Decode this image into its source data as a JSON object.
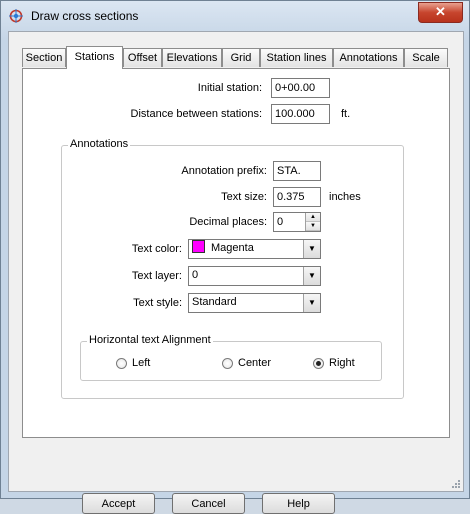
{
  "window": {
    "title": "Draw cross sections",
    "close_label": "✕"
  },
  "tabs": [
    {
      "label": "Section"
    },
    {
      "label": "Stations"
    },
    {
      "label": "Offset"
    },
    {
      "label": "Elevations"
    },
    {
      "label": "Grid"
    },
    {
      "label": "Station lines"
    },
    {
      "label": "Annotations"
    },
    {
      "label": "Scale"
    }
  ],
  "active_tab": "Stations",
  "stations": {
    "initial_station_label": "Initial station:",
    "initial_station_value": "0+00.00",
    "distance_label": "Distance between stations:",
    "distance_value": "100.000",
    "distance_unit": "ft."
  },
  "annotations": {
    "group_label": "Annotations",
    "prefix_label": "Annotation prefix:",
    "prefix_value": "STA.",
    "text_size_label": "Text size:",
    "text_size_value": "0.375",
    "text_size_unit": "inches",
    "decimal_label": "Decimal places:",
    "decimal_value": "0",
    "color_label": "Text color:",
    "color_value": "Magenta",
    "color_hex": "#ff00ff",
    "layer_label": "Text layer:",
    "layer_value": "0",
    "style_label": "Text style:",
    "style_value": "Standard"
  },
  "alignment": {
    "group_label": "Horizontal text Alignment",
    "options": [
      {
        "label": "Left",
        "selected": false
      },
      {
        "label": "Center",
        "selected": false
      },
      {
        "label": "Right",
        "selected": true
      }
    ]
  },
  "buttons": {
    "accept": "Accept",
    "cancel": "Cancel",
    "help": "Help"
  }
}
